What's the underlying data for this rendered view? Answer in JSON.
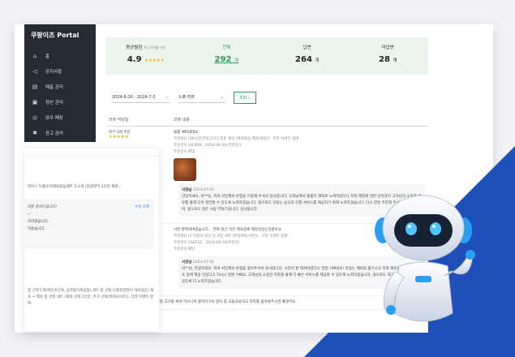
{
  "sidebar": {
    "brand": "쿠팡이츠 Portal",
    "items": [
      {
        "icon": "home-icon",
        "glyph": "⌂",
        "label": "홈"
      },
      {
        "icon": "megaphone-icon",
        "glyph": "📢",
        "label": "공지사항"
      },
      {
        "icon": "sales-icon",
        "glyph": "▤",
        "label": "매출 관리"
      },
      {
        "icon": "settlement-icon",
        "glyph": "▣",
        "label": "정산 관리"
      },
      {
        "icon": "coupon-icon",
        "glyph": "◎",
        "label": "와우 매장"
      },
      {
        "icon": "promo-icon",
        "glyph": "✱",
        "label": "광고 관리"
      }
    ]
  },
  "stats": {
    "avg_label": "평균별점",
    "avg_sub": "최근 6개월 기준",
    "avg_value": "4.9",
    "avg_stars": "★★★★★",
    "total_label": "전체",
    "total_value": "292",
    "answered_label": "답변",
    "answered_value": "264",
    "unanswered_label": "미답변",
    "unanswered_value": "28",
    "unit": "개"
  },
  "filters": {
    "date_range": "2024-6-26 - 2024-7-3",
    "review_type": "노출 리뷰",
    "query_label": "조회"
  },
  "table": {
    "col_author": "리뷰 작성일",
    "col_content": "리뷰 내용"
  },
  "reviews": [
    {
      "author": "박** 1회 주문",
      "stars": "★★★★★",
      "title": "볼륨 체피네데요",
      "order_items": "주문메뉴 [4B사진(주문고기)] 힘문 제육 (제육볶음,백반(세팅)) · 리뷰 이벤트 참여",
      "order_no": "주문번호 [ULBRK · 2024-06-30(주문일)]",
      "delivery": "주문방식 배달",
      "reply_name": "사장님",
      "reply_date": "2024-07-01",
      "reply_text": "안녕하세요, 박**님, 저희 서민제육 본점을 이용해 주셔서 감사합니다. 고객님께서 볼륨이 제대로 느껴지셨다니 저희 제정에 대한 만족감이 고객님의 소중한 리뷰를 통해 더욱 발전할 수 있도록 노력하겠습니다. 앞으로도 맛있는 음식과 친절 서비스를 제공하기 위해 노력하겠습니다. 다시 한번 주문해 주셔서 감사드리며, 앞으로도 많은 사랑 부탁드립니다. 감사합니다."
    },
    {
      "title": "사진 잘찍혀버렸습니다... 진짜 최근 먹은 제육중에 제일맛있는것같아요",
      "order_items": "주문메뉴 [2 가성비 최고 김 서민 세트 (본업제육(서민)) · 리뷰 이벤트 참여",
      "order_no": "주문번호 2SKF2Z · 2024-06-30(주문일)",
      "delivery": "주문방식 배달",
      "reply_name": "사장님",
      "reply_date": "2024-07-01",
      "reply_text": "이**님, 안녕하세요. 저희 서민제육 본점을 찾아주셔서 감사합니다. 사진이 잘 찍혀버렸다니 정말 기쁘네요! 맛있는 제육을 즐기시고 저희 제육을 최근 드신 제육 중에 제일 맛있다고 하시니 정말 기뻐요. 고객님의 소중한 리뷰를 통해 더 좋은 서비스를 제공할 수 있도록 노력하겠습니다. 앞으로도 최고의 맛을 유지할 수 있도록 더 노력하겠습니다."
    },
    {
      "title": "양도 많고 맛도 좋구! 저는 냉면하랑 고기랑 싸서 먹으니까 꿀이더구요 밥이 좀 꼬들꼬들하고 리뷰를 찾아봐주시면 좋겠어요"
    }
  ],
  "left_card": {
    "line1": "리이스 5개)오직제육볶음세트 도시락 [달걀말이 1인분 제면..",
    "reply_actions": "수정   삭제",
    "reply_lines": [
      "리뷰 감사드립니다!",
      "~",
      "리하겠습니다.",
      "하겠습니다."
    ],
    "footer": "밥 선택 1개(매운맛선택, 상관없이복음밥),세트 밥 선택 1개(달걀말이 제육볶음) 제육 + 제육 밥 선택 세트 (제육 선택 1인분, 추가 선택(특대사이즈)), 리뷰 이벤트 참여"
  }
}
